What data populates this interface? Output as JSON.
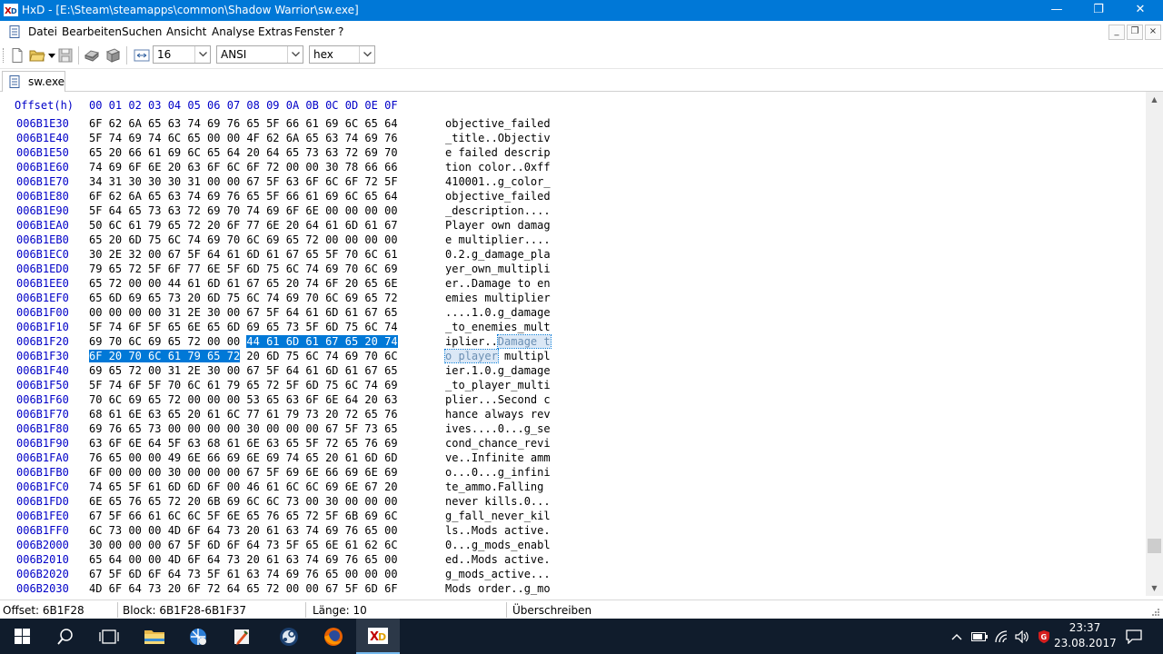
{
  "window": {
    "title": "HxD - [E:\\Steam\\steamapps\\common\\Shadow Warrior\\sw.exe]",
    "minimize_glyph": "—",
    "restore_glyph": "❐",
    "close_glyph": "✕"
  },
  "menu": {
    "items": [
      "Datei",
      "Bearbeiten",
      "Suchen",
      "Ansicht",
      "Analyse",
      "Extras",
      "Fenster",
      "?"
    ],
    "mdi_minimize": "_",
    "mdi_restore": "❐",
    "mdi_close": "×"
  },
  "toolbar": {
    "bytes_per_row": "16",
    "charset": "ANSI",
    "offset_base": "hex"
  },
  "tab": {
    "label": "sw.exe"
  },
  "editor": {
    "offset_header": "Offset(h)",
    "column_header": "00 01 02 03 04 05 06 07 08 09 0A 0B 0C 0D 0E 0F",
    "rows": [
      {
        "offset": "006B1E30",
        "hex": "6F 62 6A 65 63 74 69 76 65 5F 66 61 69 6C 65 64",
        "ascii": "objective_failed"
      },
      {
        "offset": "006B1E40",
        "hex": "5F 74 69 74 6C 65 00 00 4F 62 6A 65 63 74 69 76",
        "ascii": "_title..Objectiv"
      },
      {
        "offset": "006B1E50",
        "hex": "65 20 66 61 69 6C 65 64 20 64 65 73 63 72 69 70",
        "ascii": "e failed descrip"
      },
      {
        "offset": "006B1E60",
        "hex": "74 69 6F 6E 20 63 6F 6C 6F 72 00 00 30 78 66 66",
        "ascii": "tion color..0xff"
      },
      {
        "offset": "006B1E70",
        "hex": "34 31 30 30 30 31 00 00 67 5F 63 6F 6C 6F 72 5F",
        "ascii": "410001..g_color_"
      },
      {
        "offset": "006B1E80",
        "hex": "6F 62 6A 65 63 74 69 76 65 5F 66 61 69 6C 65 64",
        "ascii": "objective_failed"
      },
      {
        "offset": "006B1E90",
        "hex": "5F 64 65 73 63 72 69 70 74 69 6F 6E 00 00 00 00",
        "ascii": "_description...."
      },
      {
        "offset": "006B1EA0",
        "hex": "50 6C 61 79 65 72 20 6F 77 6E 20 64 61 6D 61 67",
        "ascii": "Player own damag"
      },
      {
        "offset": "006B1EB0",
        "hex": "65 20 6D 75 6C 74 69 70 6C 69 65 72 00 00 00 00",
        "ascii": "e multiplier...."
      },
      {
        "offset": "006B1EC0",
        "hex": "30 2E 32 00 67 5F 64 61 6D 61 67 65 5F 70 6C 61",
        "ascii": "0.2.g_damage_pla"
      },
      {
        "offset": "006B1ED0",
        "hex": "79 65 72 5F 6F 77 6E 5F 6D 75 6C 74 69 70 6C 69",
        "ascii": "yer_own_multipli"
      },
      {
        "offset": "006B1EE0",
        "hex": "65 72 00 00 44 61 6D 61 67 65 20 74 6F 20 65 6E",
        "ascii": "er..Damage to en"
      },
      {
        "offset": "006B1EF0",
        "hex": "65 6D 69 65 73 20 6D 75 6C 74 69 70 6C 69 65 72",
        "ascii": "emies multiplier"
      },
      {
        "offset": "006B1F00",
        "hex": "00 00 00 00 31 2E 30 00 67 5F 64 61 6D 61 67 65",
        "ascii": "....1.0.g_damage"
      },
      {
        "offset": "006B1F10",
        "hex": "5F 74 6F 5F 65 6E 65 6D 69 65 73 5F 6D 75 6C 74",
        "ascii": "_to_enemies_mult"
      },
      {
        "offset": "006B1F20",
        "hex": "69 70 6C 69 65 72 00 00 44 61 6D 61 67 65 20 74",
        "ascii": "iplier..Damage t",
        "sel_from": 8
      },
      {
        "offset": "006B1F30",
        "hex": "6F 20 70 6C 61 79 65 72 20 6D 75 6C 74 69 70 6C",
        "ascii": "o player multipl",
        "sel_to": 8
      },
      {
        "offset": "006B1F40",
        "hex": "69 65 72 00 31 2E 30 00 67 5F 64 61 6D 61 67 65",
        "ascii": "ier.1.0.g_damage"
      },
      {
        "offset": "006B1F50",
        "hex": "5F 74 6F 5F 70 6C 61 79 65 72 5F 6D 75 6C 74 69",
        "ascii": "_to_player_multi"
      },
      {
        "offset": "006B1F60",
        "hex": "70 6C 69 65 72 00 00 00 53 65 63 6F 6E 64 20 63",
        "ascii": "plier...Second c"
      },
      {
        "offset": "006B1F70",
        "hex": "68 61 6E 63 65 20 61 6C 77 61 79 73 20 72 65 76",
        "ascii": "hance always rev"
      },
      {
        "offset": "006B1F80",
        "hex": "69 76 65 73 00 00 00 00 30 00 00 00 67 5F 73 65",
        "ascii": "ives....0...g_se"
      },
      {
        "offset": "006B1F90",
        "hex": "63 6F 6E 64 5F 63 68 61 6E 63 65 5F 72 65 76 69",
        "ascii": "cond_chance_revi"
      },
      {
        "offset": "006B1FA0",
        "hex": "76 65 00 00 49 6E 66 69 6E 69 74 65 20 61 6D 6D",
        "ascii": "ve..Infinite amm"
      },
      {
        "offset": "006B1FB0",
        "hex": "6F 00 00 00 30 00 00 00 67 5F 69 6E 66 69 6E 69",
        "ascii": "o...0...g_infini"
      },
      {
        "offset": "006B1FC0",
        "hex": "74 65 5F 61 6D 6D 6F 00 46 61 6C 6C 69 6E 67 20",
        "ascii": "te_ammo.Falling "
      },
      {
        "offset": "006B1FD0",
        "hex": "6E 65 76 65 72 20 6B 69 6C 6C 73 00 30 00 00 00",
        "ascii": "never kills.0..."
      },
      {
        "offset": "006B1FE0",
        "hex": "67 5F 66 61 6C 6C 5F 6E 65 76 65 72 5F 6B 69 6C",
        "ascii": "g_fall_never_kil"
      },
      {
        "offset": "006B1FF0",
        "hex": "6C 73 00 00 4D 6F 64 73 20 61 63 74 69 76 65 00",
        "ascii": "ls..Mods active."
      },
      {
        "offset": "006B2000",
        "hex": "30 00 00 00 67 5F 6D 6F 64 73 5F 65 6E 61 62 6C",
        "ascii": "0...g_mods_enabl"
      },
      {
        "offset": "006B2010",
        "hex": "65 64 00 00 4D 6F 64 73 20 61 63 74 69 76 65 00",
        "ascii": "ed..Mods active."
      },
      {
        "offset": "006B2020",
        "hex": "67 5F 6D 6F 64 73 5F 61 63 74 69 76 65 00 00 00",
        "ascii": "g_mods_active..."
      },
      {
        "offset": "006B2030",
        "hex": "4D 6F 64 73 20 6F 72 64 65 72 00 00 67 5F 6D 6F",
        "ascii": "Mods order..g_mo"
      }
    ]
  },
  "status": {
    "offset": "Offset: 6B1F28",
    "block": "Block: 6B1F28-6B1F37",
    "length": "Länge: 10",
    "mode": "Überschreiben"
  },
  "taskbar": {
    "clock_time": "23:37",
    "clock_date": "23.08.2017",
    "active_app": "hxd-taskbar-button"
  }
}
